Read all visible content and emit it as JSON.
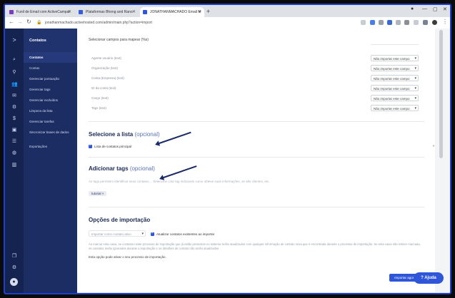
{
  "browser": {
    "tabs": [
      {
        "label": "Funil de Email com ActiveCampai",
        "color": "#7a3cc4"
      },
      {
        "label": "Plataformas Bhong and Rano",
        "color": "#3a5bd9"
      },
      {
        "label": "JONATHANMACHADO Email M",
        "color": "#2f56d9"
      }
    ],
    "url": "jonathanmachado.activehosted.com/admin/main.php?action=import"
  },
  "menu": {
    "header": "Contatos",
    "items": [
      "Contatos",
      "Contas",
      "Gerenciar pontuação",
      "Gerenciar tags",
      "Gerenciar excluídos",
      "Limpeza da lista",
      "Gerenciar tarefas",
      "Sincronizar bases de dados",
      "Exportações"
    ]
  },
  "mapping": {
    "heading": "Selecionar campos para mapear (%s)",
    "rows": [
      {
        "label": "Agente usuário (text)",
        "value": "Não importar este campo"
      },
      {
        "label": "Organização (text)",
        "value": "Não importar este campo"
      },
      {
        "label": "Conta (Empresa) (text)",
        "value": "Não importar este campo"
      },
      {
        "label": "ID da conta (text)",
        "value": "Não importar este campo"
      },
      {
        "label": "Cargo (text)",
        "value": "Não importar este campo"
      },
      {
        "label": "Tags (text)",
        "value": "Não importar este campo"
      }
    ]
  },
  "list_section": {
    "title": "Selecione a lista",
    "optional": "(opcional)",
    "checkbox_label": "Lista de contatos principal"
  },
  "tags_section": {
    "title": "Adicionar tags",
    "optional": "(opcional)",
    "help": "As tags permitem identificar seus contatos… Selecione criar tag indicando como obteve suas informações, se são clientes, etc.",
    "tag": "tutorial"
  },
  "import_section": {
    "title": "Opções de importação",
    "status_select": "Importar como contato ativo",
    "update_label": "Atualizar contatos existentes ao importar",
    "description": "Ao marcar esta caixa, se contatos neste processo de importação que já estão presentes no sistema serão atualizados com qualquer informação de contato nova que é encontrada durante o processo de importação. Se esta caixa não estiver marcada, os contatos serão ignorados durante a importação e os detalhes de contato não serão atualizados.",
    "note": "Esta opção pode ativar o seu processo de importação."
  },
  "actions": {
    "submit": "Importar agora",
    "help": "Ajuda"
  },
  "colors": {
    "sidebar": "#1c2d63",
    "rail": "#14234f",
    "accent": "#2f56d9"
  }
}
